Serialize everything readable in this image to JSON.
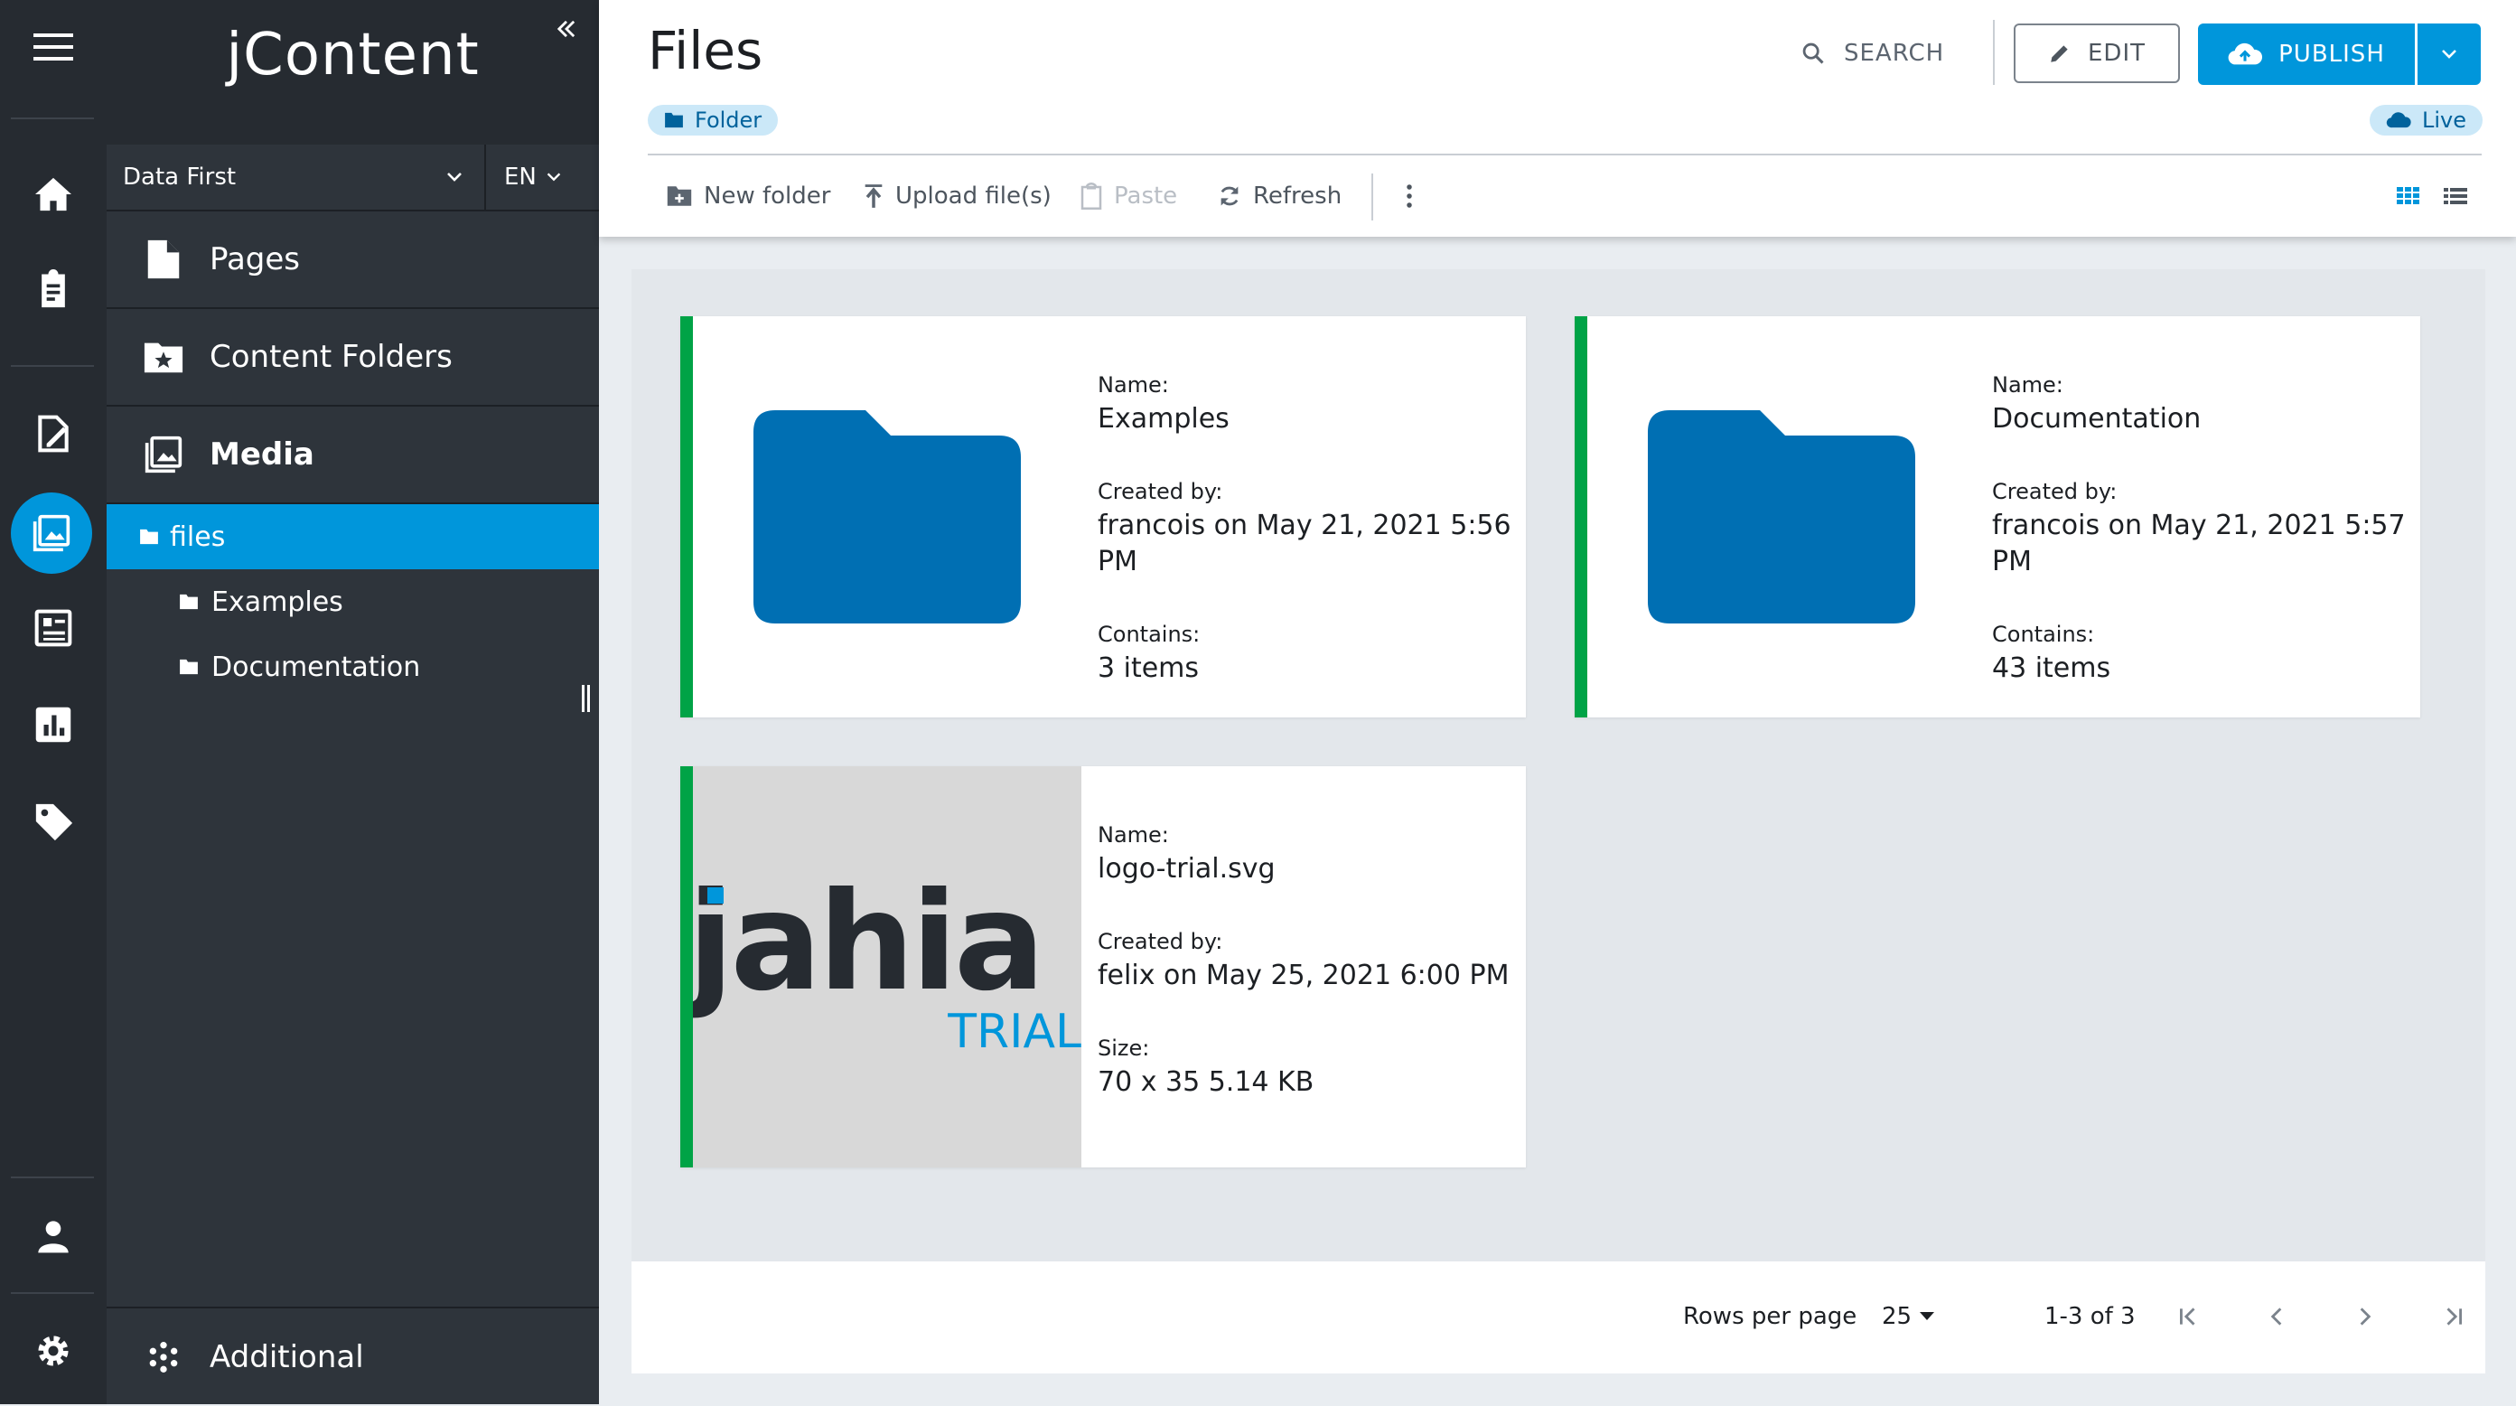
{
  "app": {
    "brand": "jContent",
    "collapse_icon": "double-chevron-left-icon"
  },
  "rail": {
    "items": [
      "menu-icon",
      "home-icon",
      "clipboard-icon",
      "page-edit-icon",
      "media-icon",
      "form-icon",
      "analytics-icon",
      "tag-icon",
      "user-icon",
      "settings-icon"
    ],
    "active": "media-icon"
  },
  "nav": {
    "site": "Data First",
    "language": "EN",
    "accordions": [
      {
        "label": "Pages",
        "icon": "page-icon"
      },
      {
        "label": "Content Folders",
        "icon": "star-folder-icon"
      },
      {
        "label": "Media",
        "icon": "media-icon"
      }
    ],
    "tree": [
      {
        "label": "files",
        "selected": true
      },
      {
        "label": "Examples",
        "selected": false
      },
      {
        "label": "Documentation",
        "selected": false
      }
    ],
    "additional": "Additional"
  },
  "header": {
    "title": "Files",
    "type_chip": "Folder",
    "status_chip": "Live",
    "search": "SEARCH",
    "edit": "EDIT",
    "publish": "PUBLISH"
  },
  "toolbar": {
    "new_folder": "New folder",
    "upload": "Upload file(s)",
    "paste": "Paste",
    "refresh": "Refresh",
    "view_modes": [
      "grid-view-icon",
      "list-view-icon"
    ],
    "active_view": "grid-view-icon"
  },
  "labels": {
    "name": "Name:",
    "created_by": "Created by:",
    "contains": "Contains:",
    "size": "Size:"
  },
  "cards": [
    {
      "name": "Examples",
      "created_by": "francois on May 21, 2021 5:56 PM",
      "contains": "3 items",
      "kind": "folder"
    },
    {
      "name": "Documentation",
      "created_by": "francois on May 21, 2021 5:57 PM",
      "contains": "43 items",
      "kind": "folder"
    },
    {
      "name": "logo-trial.svg",
      "created_by": "felix on May 25, 2021 6:00 PM",
      "size": "70 x 35 5.14 KB",
      "kind": "image",
      "logo_text": "jahia",
      "logo_subtext": "TRIAL"
    }
  ],
  "pagination": {
    "rows_label": "Rows per page",
    "rows_value": "25",
    "range": "1-3 of 3"
  },
  "colors": {
    "accent": "#0096db",
    "folder": "#006fb3",
    "published_bar": "#00a346",
    "sidebar": "#2e343b",
    "rail": "#262b31"
  }
}
